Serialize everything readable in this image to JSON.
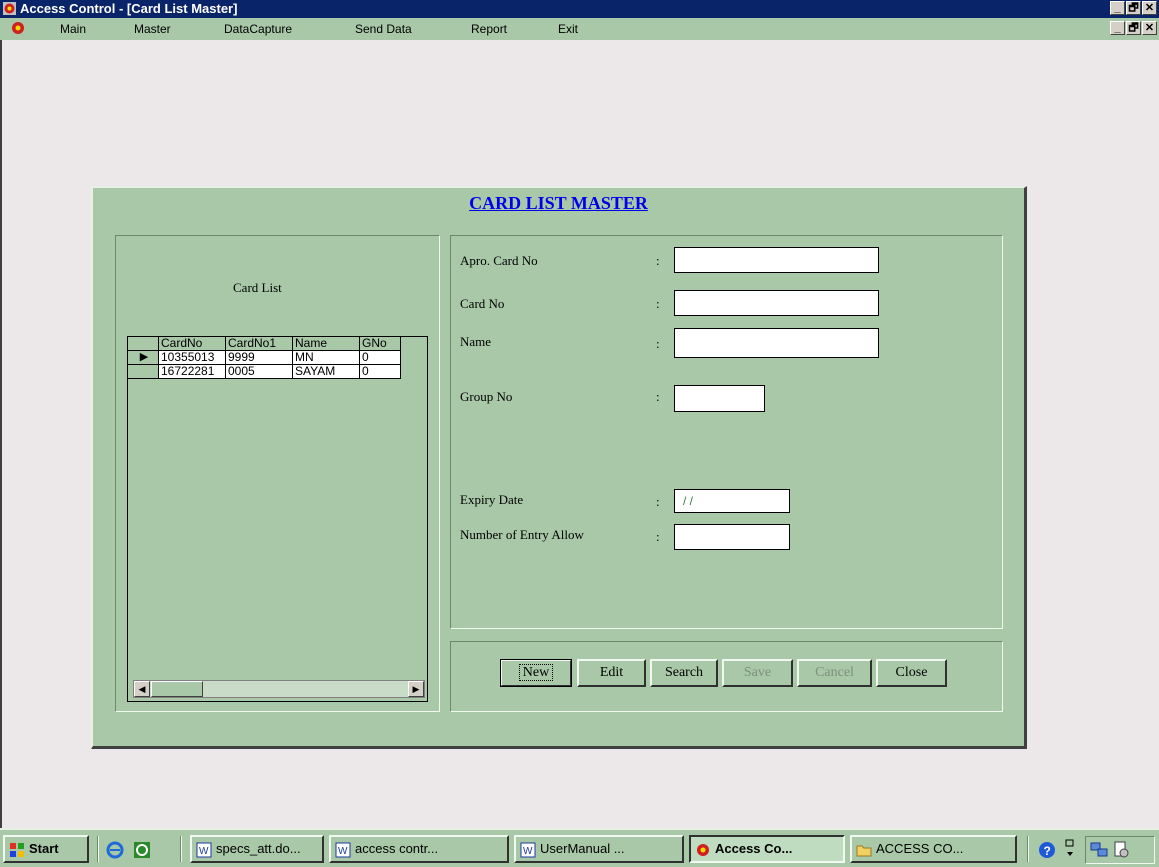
{
  "window": {
    "title": "Access Control - [Card List Master]"
  },
  "menu": {
    "items": [
      "Main",
      "Master",
      "DataCapture",
      "Send Data",
      "Report",
      "Exit"
    ]
  },
  "form": {
    "title": "CARD LIST MASTER",
    "card_list_label": "Card List",
    "fields": {
      "apro_card_no": {
        "label": "Apro. Card No",
        "value": ""
      },
      "card_no": {
        "label": "Card No",
        "value": ""
      },
      "name": {
        "label": "Name",
        "value": ""
      },
      "group_no": {
        "label": "Group No",
        "value": ""
      },
      "expiry_date": {
        "label": "Expiry Date",
        "value": "/ /"
      },
      "entries_allowed": {
        "label": "Number of Entry Allow",
        "value": ""
      }
    },
    "colon": ":"
  },
  "grid": {
    "columns": [
      "CardNo",
      "CardNo1",
      "Name",
      "GNo"
    ],
    "rows": [
      [
        "10355013",
        "9999",
        "MN",
        "0"
      ],
      [
        "16722281",
        "0005",
        "SAYAM",
        "0"
      ]
    ],
    "current_row_marker": "▶"
  },
  "buttons": {
    "new": "New",
    "edit": "Edit",
    "search": "Search",
    "save": "Save",
    "cancel": "Cancel",
    "close": "Close"
  },
  "window_controls": [
    "_",
    "🗗",
    "✕"
  ],
  "taskbar": {
    "start": "Start",
    "tasks": [
      {
        "label": "specs_att.do...",
        "icon": "word-doc-icon",
        "active": false
      },
      {
        "label": "access contr...",
        "icon": "word-doc-icon",
        "active": false
      },
      {
        "label": "UserManual ...",
        "icon": "word-doc-icon",
        "active": false
      },
      {
        "label": "Access Co...",
        "icon": "access-app-icon",
        "active": true
      },
      {
        "label": "ACCESS CO...",
        "icon": "folder-icon",
        "active": false
      }
    ]
  }
}
